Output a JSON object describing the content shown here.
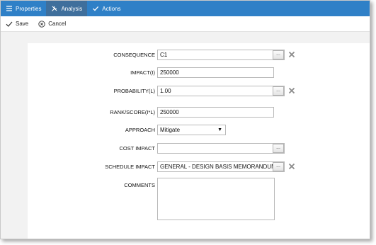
{
  "tabs": [
    {
      "label": "Properties",
      "icon": "list-icon",
      "active": false
    },
    {
      "label": "Analysis",
      "icon": "tools-icon",
      "active": true
    },
    {
      "label": "Actions",
      "icon": "checkmark-icon",
      "active": false
    }
  ],
  "toolbar": {
    "save_label": "Save",
    "cancel_label": "Cancel"
  },
  "form": {
    "consequence": {
      "label": "CONSEQUENCE",
      "value": "C1"
    },
    "impact": {
      "label": "IMPACT(I)",
      "value": "250000"
    },
    "probability": {
      "label": "PROBABILITY(L)",
      "value": "1.00"
    },
    "rank_score": {
      "label": "RANK/SCORE(I*L)",
      "value": "250000"
    },
    "approach": {
      "label": "APPROACH",
      "value": "Mitigate"
    },
    "cost_impact": {
      "label": "COST IMPACT",
      "value": ""
    },
    "schedule_impact": {
      "label": "SCHEDULE IMPACT",
      "value": "GENERAL - DESIGN BASIS MEMORANDUM,FA"
    },
    "comments": {
      "label": "COMMENTS",
      "value": ""
    }
  },
  "lookup_button_label": "...",
  "colors": {
    "tab_bar": "#2f80c7",
    "tab_active": "#3f6f9c",
    "page_bg": "#f2f2f2",
    "panel_bg": "#ffffff"
  }
}
